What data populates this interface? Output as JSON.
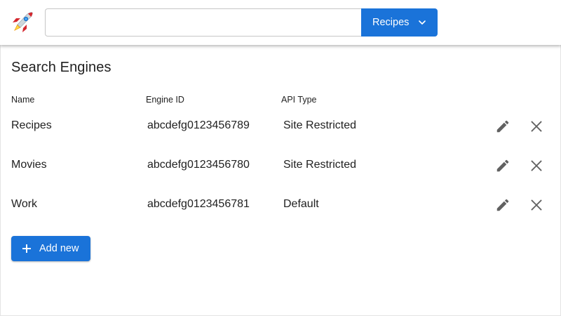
{
  "header": {
    "logo_icon": "rocket-icon",
    "search": {
      "value": "",
      "placeholder": ""
    },
    "engine_select": {
      "label": "Recipes",
      "icon": "chevron-down-icon"
    }
  },
  "page": {
    "title": "Search Engines",
    "columns": {
      "name": "Name",
      "engine_id": "Engine ID",
      "api_type": "API Type"
    },
    "rows": [
      {
        "name": "Recipes",
        "engine_id": "abcdefg0123456789",
        "api_type": "Site Restricted"
      },
      {
        "name": "Movies",
        "engine_id": "abcdefg0123456780",
        "api_type": "Site Restricted"
      },
      {
        "name": "Work",
        "engine_id": "abcdefg0123456781",
        "api_type": "Default"
      }
    ],
    "row_icons": {
      "edit": "pencil-icon",
      "delete": "close-icon"
    },
    "add_button": {
      "label": "Add new",
      "icon": "plus-icon"
    }
  },
  "colors": {
    "accent": "#1a73d9",
    "icon_gray": "#616161"
  }
}
